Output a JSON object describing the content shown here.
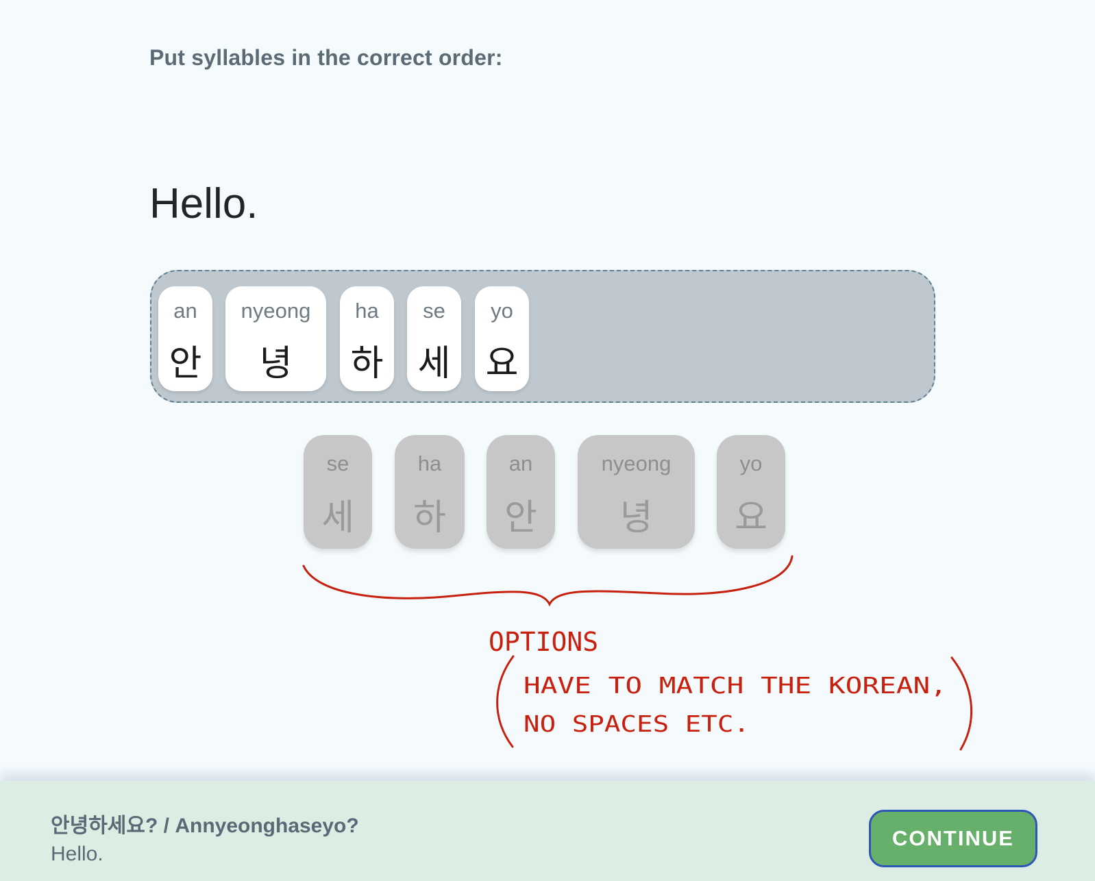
{
  "instruction": "Put syllables in the correct order:",
  "prompt": "Hello.",
  "answer_tiles": [
    {
      "rom": "an",
      "kor": "안"
    },
    {
      "rom": "nyeong",
      "kor": "녕"
    },
    {
      "rom": "ha",
      "kor": "하"
    },
    {
      "rom": "se",
      "kor": "세"
    },
    {
      "rom": "yo",
      "kor": "요"
    }
  ],
  "option_tiles": [
    {
      "rom": "se",
      "kor": "세"
    },
    {
      "rom": "ha",
      "kor": "하"
    },
    {
      "rom": "an",
      "kor": "안"
    },
    {
      "rom": "nyeong",
      "kor": "녕"
    },
    {
      "rom": "yo",
      "kor": "요"
    }
  ],
  "annotation": {
    "label": "OPTIONS",
    "line1": "HAVE TO MATCH THE KOREAN,",
    "line2": "NO SPACES ETC.",
    "color": "#c8200e"
  },
  "footer": {
    "answer": "안녕하세요? / Annyeonghaseyo?",
    "translation": "Hello.",
    "continue_label": "CONTINUE"
  },
  "colors": {
    "background": "#f5fafd",
    "answer_area": "#bec8ce",
    "option_tile": "#c7c7c7",
    "footer": "#dceee3",
    "continue_button": "#67b06b",
    "continue_border": "#2d56b8"
  }
}
